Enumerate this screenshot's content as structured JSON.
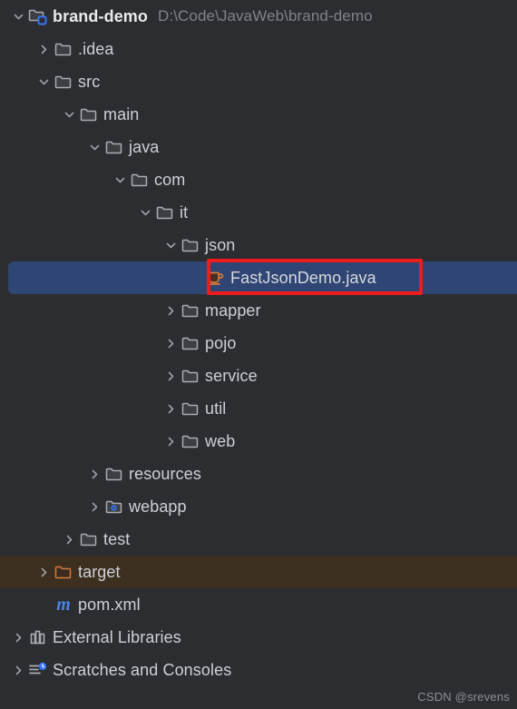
{
  "window": {
    "background_color": "#2B2D30",
    "text_color": "#CED0D6",
    "selection_color": "#2F4573",
    "excluded_row_color": "#3D2F20",
    "annotation_color": "#EE1C1C"
  },
  "project": {
    "name": "brand-demo",
    "path": "D:\\Code\\JavaWeb\\brand-demo"
  },
  "tree": {
    "rows": [
      {
        "label": "brand-demo",
        "path": "D:\\Code\\JavaWeb\\brand-demo",
        "depth": 0,
        "twisty": "expanded",
        "icon": "module-folder-icon",
        "root": true
      },
      {
        "label": ".idea",
        "depth": 1,
        "twisty": "collapsed",
        "icon": "folder-icon"
      },
      {
        "label": "src",
        "depth": 1,
        "twisty": "expanded",
        "icon": "folder-icon"
      },
      {
        "label": "main",
        "depth": 2,
        "twisty": "expanded",
        "icon": "folder-icon"
      },
      {
        "label": "java",
        "depth": 3,
        "twisty": "expanded",
        "icon": "folder-icon"
      },
      {
        "label": "com",
        "depth": 4,
        "twisty": "expanded",
        "icon": "folder-icon"
      },
      {
        "label": "it",
        "depth": 5,
        "twisty": "expanded",
        "icon": "folder-icon"
      },
      {
        "label": "json",
        "depth": 6,
        "twisty": "expanded",
        "icon": "folder-icon"
      },
      {
        "label": "FastJsonDemo.java",
        "depth": 7,
        "twisty": "none",
        "icon": "java-class-icon",
        "selected": true,
        "annotated": true
      },
      {
        "label": "mapper",
        "depth": 6,
        "twisty": "collapsed",
        "icon": "folder-icon"
      },
      {
        "label": "pojo",
        "depth": 6,
        "twisty": "collapsed",
        "icon": "folder-icon"
      },
      {
        "label": "service",
        "depth": 6,
        "twisty": "collapsed",
        "icon": "folder-icon"
      },
      {
        "label": "util",
        "depth": 6,
        "twisty": "collapsed",
        "icon": "folder-icon"
      },
      {
        "label": "web",
        "depth": 6,
        "twisty": "collapsed",
        "icon": "folder-icon"
      },
      {
        "label": "resources",
        "depth": 3,
        "twisty": "collapsed",
        "icon": "folder-icon"
      },
      {
        "label": "webapp",
        "depth": 3,
        "twisty": "collapsed",
        "icon": "web-folder-icon"
      },
      {
        "label": "test",
        "depth": 2,
        "twisty": "collapsed",
        "icon": "folder-icon"
      },
      {
        "label": "target",
        "depth": 1,
        "twisty": "collapsed",
        "icon": "excluded-folder-icon",
        "excluded": true
      },
      {
        "label": "pom.xml",
        "depth": 1,
        "twisty": "none",
        "icon": "maven-icon"
      },
      {
        "label": "External Libraries",
        "depth": 0,
        "twisty": "collapsed",
        "icon": "library-icon"
      },
      {
        "label": "Scratches and Consoles",
        "depth": 0,
        "twisty": "collapsed",
        "icon": "scratches-icon"
      }
    ]
  },
  "annotation": {
    "kind": "red-rectangle",
    "target_label": "FastJsonDemo.java"
  },
  "watermark": {
    "text": "CSDN @srevens"
  }
}
